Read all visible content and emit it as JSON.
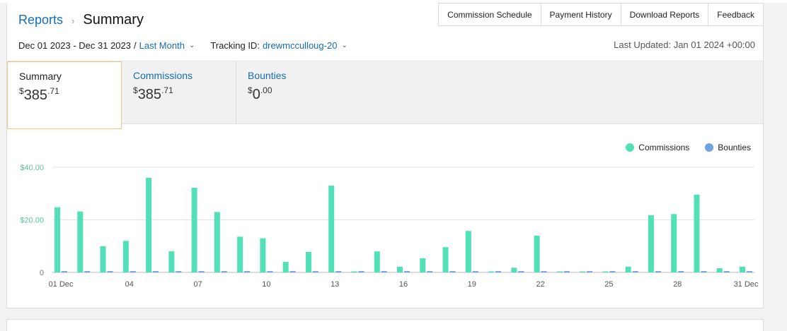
{
  "breadcrumb": {
    "parent": "Reports",
    "separator": "›",
    "current": "Summary"
  },
  "top_links": [
    "Commission Schedule",
    "Payment History",
    "Download Reports",
    "Feedback"
  ],
  "filters": {
    "date_range": "Dec 01 2023 - Dec 31 2023",
    "slash": "/",
    "period": "Last Month",
    "tracking_label": "Tracking ID:",
    "tracking_id": "drewmcculloug-20",
    "chevron": "⌄"
  },
  "last_updated": "Last Updated: Jan 01 2024 +00:00",
  "tabs": {
    "summary": {
      "label": "Summary",
      "currency": "$",
      "whole": "385",
      "cents": ".71"
    },
    "commissions": {
      "label": "Commissions",
      "currency": "$",
      "whole": "385",
      "cents": ".71"
    },
    "bounties": {
      "label": "Bounties",
      "currency": "$",
      "whole": "0",
      "cents": ".00"
    }
  },
  "colors": {
    "commissions": "#52e0b8",
    "bounties": "#6ea2e0",
    "accent": "#146eb4",
    "tab_border": "#f0c58a"
  },
  "chart_data": {
    "type": "bar",
    "title": "",
    "xlabel": "",
    "ylabel": "",
    "ylim": [
      0,
      40
    ],
    "y_ticks": [
      0,
      20,
      40
    ],
    "y_tick_labels": [
      "0",
      "$20.00",
      "$40.00"
    ],
    "grid": true,
    "legend_position": "top-right",
    "categories": [
      "01 Dec",
      "02",
      "03",
      "04",
      "05",
      "06",
      "07",
      "08",
      "09",
      "10",
      "11",
      "12",
      "13",
      "14",
      "15",
      "16",
      "17",
      "18",
      "19",
      "20",
      "21",
      "22",
      "23",
      "24",
      "25",
      "26",
      "27",
      "28",
      "29",
      "30",
      "31 Dec"
    ],
    "x_tick_labels": [
      "01 Dec",
      "04",
      "07",
      "10",
      "13",
      "16",
      "19",
      "22",
      "25",
      "28",
      "31 Dec"
    ],
    "x_tick_indices": [
      0,
      3,
      6,
      9,
      12,
      15,
      18,
      21,
      24,
      27,
      30
    ],
    "series": [
      {
        "name": "Commissions",
        "color": "#52e0b8",
        "values": [
          24.8,
          23.2,
          10.0,
          12.0,
          36.0,
          8.0,
          32.2,
          23.0,
          13.6,
          13.0,
          4.0,
          7.8,
          33.0,
          0.4,
          8.0,
          2.2,
          5.4,
          9.6,
          15.8,
          0.4,
          1.8,
          14.0,
          0.4,
          0.4,
          0.4,
          2.2,
          21.8,
          22.2,
          29.6,
          1.6,
          2.2
        ]
      },
      {
        "name": "Bounties",
        "color": "#6ea2e0",
        "values": [
          0.5,
          0.5,
          0.5,
          0.5,
          0.5,
          0.5,
          0.5,
          0.5,
          0.5,
          0.5,
          0.5,
          0.5,
          0.5,
          0.5,
          0.5,
          0.5,
          0.5,
          0.5,
          0.5,
          0.5,
          0.5,
          0.5,
          0.5,
          0.5,
          0.5,
          0.5,
          0.5,
          0.5,
          0.5,
          0.5,
          0.5
        ]
      }
    ]
  }
}
